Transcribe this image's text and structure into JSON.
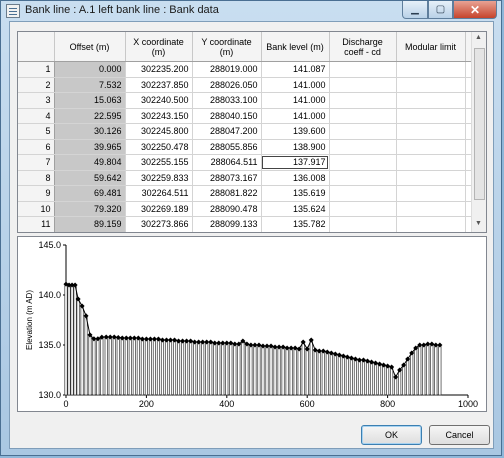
{
  "window": {
    "title": "Bank line : A.1 left bank line : Bank data",
    "controls": {
      "minimize": "▁",
      "maximize": "▢",
      "close": "✕"
    }
  },
  "table": {
    "columns": [
      "Offset (m)",
      "X coordinate (m)",
      "Y coordinate (m)",
      "Bank level (m)",
      "Discharge coeff - cd",
      "Modular limit"
    ],
    "rows": [
      {
        "n": "1",
        "offset": "0.000",
        "x": "302235.200",
        "y": "288019.000",
        "level": "141.087",
        "cd": "",
        "modular": ""
      },
      {
        "n": "2",
        "offset": "7.532",
        "x": "302237.850",
        "y": "288026.050",
        "level": "141.000",
        "cd": "",
        "modular": ""
      },
      {
        "n": "3",
        "offset": "15.063",
        "x": "302240.500",
        "y": "288033.100",
        "level": "141.000",
        "cd": "",
        "modular": ""
      },
      {
        "n": "4",
        "offset": "22.595",
        "x": "302243.150",
        "y": "288040.150",
        "level": "141.000",
        "cd": "",
        "modular": ""
      },
      {
        "n": "5",
        "offset": "30.126",
        "x": "302245.800",
        "y": "288047.200",
        "level": "139.600",
        "cd": "",
        "modular": ""
      },
      {
        "n": "6",
        "offset": "39.965",
        "x": "302250.478",
        "y": "288055.856",
        "level": "138.900",
        "cd": "",
        "modular": ""
      },
      {
        "n": "7",
        "offset": "49.804",
        "x": "302255.155",
        "y": "288064.511",
        "level": "137.917",
        "cd": "",
        "modular": ""
      },
      {
        "n": "8",
        "offset": "59.642",
        "x": "302259.833",
        "y": "288073.167",
        "level": "136.008",
        "cd": "",
        "modular": ""
      },
      {
        "n": "9",
        "offset": "69.481",
        "x": "302264.511",
        "y": "288081.822",
        "level": "135.619",
        "cd": "",
        "modular": ""
      },
      {
        "n": "10",
        "offset": "79.320",
        "x": "302269.189",
        "y": "288090.478",
        "level": "135.624",
        "cd": "",
        "modular": ""
      },
      {
        "n": "11",
        "offset": "89.159",
        "x": "302273.866",
        "y": "288099.133",
        "level": "135.782",
        "cd": "",
        "modular": ""
      }
    ],
    "selected_row": 6
  },
  "chart_data": {
    "type": "bar",
    "xlabel": "Offset (m)",
    "ylabel": "Elevation (m AD)",
    "xlim": [
      0,
      1000
    ],
    "ylim": [
      130,
      145
    ],
    "xticks": [
      "0",
      "200",
      "400",
      "600",
      "800",
      "1000"
    ],
    "yticks": [
      "130.0",
      "135.0",
      "140.0",
      "145.0"
    ],
    "x": [
      0,
      7.532,
      15.063,
      22.595,
      30.126,
      39.965,
      49.804,
      59.642,
      69.481,
      79.32,
      89.159,
      100,
      110,
      120,
      130,
      140,
      150,
      160,
      170,
      180,
      190,
      200,
      210,
      220,
      230,
      240,
      250,
      260,
      270,
      280,
      290,
      300,
      310,
      320,
      330,
      340,
      350,
      360,
      370,
      380,
      390,
      400,
      410,
      420,
      430,
      440,
      450,
      460,
      470,
      480,
      490,
      500,
      510,
      520,
      530,
      540,
      550,
      560,
      570,
      580,
      590,
      600,
      610,
      620,
      630,
      640,
      650,
      660,
      670,
      680,
      690,
      700,
      710,
      720,
      730,
      740,
      750,
      760,
      770,
      780,
      790,
      800,
      810,
      820,
      830,
      840,
      850,
      860,
      870,
      880,
      890,
      900,
      910,
      920,
      930
    ],
    "values": [
      141.087,
      141.0,
      141.0,
      141.0,
      139.6,
      138.9,
      137.917,
      136.008,
      135.619,
      135.624,
      135.782,
      135.8,
      135.8,
      135.8,
      135.75,
      135.7,
      135.7,
      135.7,
      135.7,
      135.7,
      135.6,
      135.6,
      135.6,
      135.6,
      135.6,
      135.5,
      135.5,
      135.5,
      135.5,
      135.4,
      135.4,
      135.4,
      135.4,
      135.3,
      135.3,
      135.3,
      135.3,
      135.3,
      135.2,
      135.2,
      135.2,
      135.2,
      135.2,
      135.1,
      135.1,
      135.4,
      135.1,
      135.0,
      135.0,
      135.0,
      134.9,
      134.9,
      134.9,
      134.8,
      134.8,
      134.8,
      134.7,
      134.7,
      134.7,
      134.6,
      135.3,
      134.6,
      135.5,
      134.5,
      134.4,
      134.4,
      134.3,
      134.2,
      134.1,
      134.0,
      133.9,
      133.8,
      133.7,
      133.6,
      133.5,
      133.5,
      133.4,
      133.3,
      133.2,
      133.1,
      133.0,
      132.9,
      132.8,
      131.8,
      132.5,
      133.0,
      133.6,
      134.2,
      134.7,
      135.0,
      135.0,
      135.1,
      135.1,
      135.0,
      135.0
    ]
  },
  "buttons": {
    "ok": "OK",
    "cancel": "Cancel"
  }
}
